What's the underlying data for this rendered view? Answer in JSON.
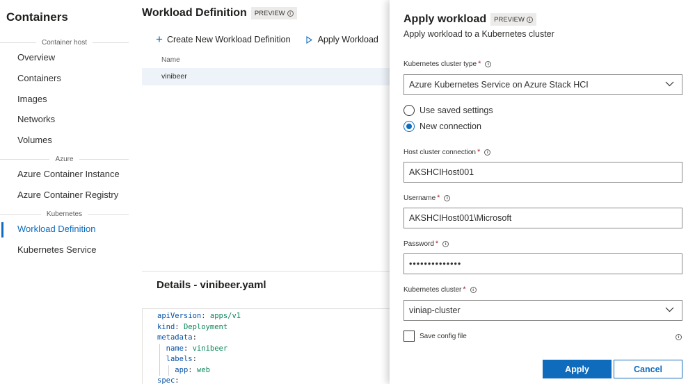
{
  "sidebar": {
    "title": "Containers",
    "sections": [
      {
        "label": "Container host"
      },
      {
        "label": "Azure"
      },
      {
        "label": "Kubernetes"
      }
    ],
    "items": [
      {
        "label": "Overview"
      },
      {
        "label": "Containers"
      },
      {
        "label": "Images"
      },
      {
        "label": "Networks"
      },
      {
        "label": "Volumes"
      },
      {
        "label": "Azure Container Instance"
      },
      {
        "label": "Azure Container Registry"
      },
      {
        "label": "Workload Definition",
        "active": true
      },
      {
        "label": "Kubernetes Service"
      }
    ]
  },
  "main": {
    "title": "Workload Definition",
    "badge": "PREVIEW",
    "toolbar": {
      "create_label": "Create New Workload Definition",
      "apply_label": "Apply Workload"
    },
    "table": {
      "column": "Name",
      "rows": [
        "vinibeer"
      ]
    },
    "details_title": "Details - vinibeer.yaml",
    "code": [
      {
        "key": "apiVersion",
        "value": "apps/v1"
      },
      {
        "key": "kind",
        "value": "Deployment"
      },
      {
        "key": "metadata",
        "value": ""
      },
      {
        "key": "name",
        "value": "vinibeer"
      },
      {
        "key": "labels",
        "value": ""
      },
      {
        "key": "app",
        "value": "web"
      },
      {
        "key": "spec",
        "value": ""
      }
    ]
  },
  "panel": {
    "title": "Apply workload",
    "badge": "PREVIEW",
    "subtitle": "Apply workload to a Kubernetes cluster",
    "cluster_type_label": "Kubernetes cluster type",
    "cluster_type_value": "Azure Kubernetes Service on Azure Stack HCI",
    "radio_saved": "Use saved settings",
    "radio_new": "New connection",
    "host_label": "Host cluster connection",
    "host_value": "AKSHCIHost001",
    "username_label": "Username",
    "username_value": "AKSHCIHost001\\Microsoft",
    "password_label": "Password",
    "password_value": "••••••••••••••",
    "cluster_label": "Kubernetes cluster",
    "cluster_value": "viniap-cluster",
    "save_config_label": "Save config file",
    "apply_button": "Apply",
    "cancel_button": "Cancel"
  }
}
